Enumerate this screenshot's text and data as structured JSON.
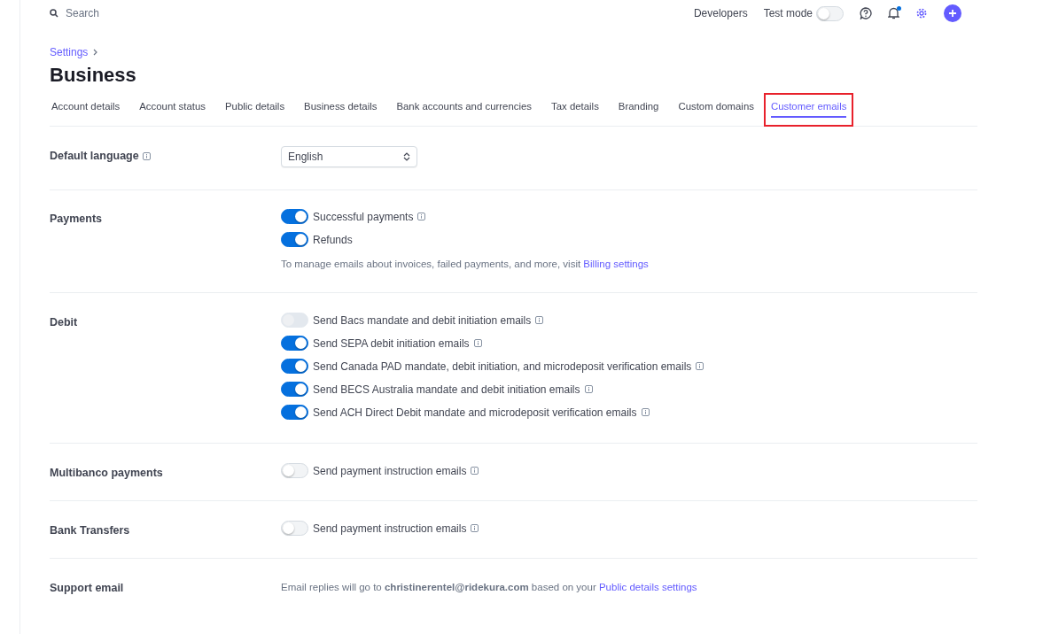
{
  "topbar": {
    "search": {
      "placeholder": "Search"
    },
    "developers": "Developers",
    "test_mode": {
      "label": "Test mode",
      "on": false
    }
  },
  "breadcrumb": "Settings",
  "title": "Business",
  "tabs": [
    {
      "label": "Account details",
      "selected": false,
      "highlighted": false
    },
    {
      "label": "Account status",
      "selected": false,
      "highlighted": false
    },
    {
      "label": "Public details",
      "selected": false,
      "highlighted": false
    },
    {
      "label": "Business details",
      "selected": false,
      "highlighted": false
    },
    {
      "label": "Bank accounts and currencies",
      "selected": false,
      "highlighted": false
    },
    {
      "label": "Tax details",
      "selected": false,
      "highlighted": false
    },
    {
      "label": "Branding",
      "selected": false,
      "highlighted": false
    },
    {
      "label": "Custom domains",
      "selected": false,
      "highlighted": false
    },
    {
      "label": "Customer emails",
      "selected": true,
      "highlighted": true
    }
  ],
  "sections": [
    {
      "kind": "select",
      "label": "Default language",
      "info": true,
      "value": "English"
    },
    {
      "kind": "toggles",
      "label": "Payments",
      "toggles": [
        {
          "label": "Successful payments",
          "on": true,
          "disabled": false,
          "info": true
        },
        {
          "label": "Refunds",
          "on": true,
          "disabled": false,
          "info": false
        }
      ],
      "note": {
        "text": "To manage emails about invoices, failed payments, and more, visit",
        "link": "Billing settings"
      }
    },
    {
      "kind": "toggles",
      "label": "Debit",
      "toggles": [
        {
          "label": "Send Bacs mandate and debit initiation emails",
          "on": false,
          "disabled": true,
          "info": true
        },
        {
          "label": "Send SEPA debit initiation emails",
          "on": true,
          "disabled": false,
          "info": true
        },
        {
          "label": "Send Canada PAD mandate, debit initiation, and microdeposit verification emails",
          "on": true,
          "disabled": false,
          "info": true
        },
        {
          "label": "Send BECS Australia mandate and debit initiation emails",
          "on": true,
          "disabled": false,
          "info": true
        },
        {
          "label": "Send ACH Direct Debit mandate and microdeposit verification emails",
          "on": true,
          "disabled": false,
          "info": true
        }
      ]
    },
    {
      "kind": "toggles",
      "label": "Multibanco payments",
      "toggles": [
        {
          "label": "Send payment instruction emails",
          "on": false,
          "disabled": false,
          "info": true
        }
      ]
    },
    {
      "kind": "toggles",
      "label": "Bank Transfers",
      "toggles": [
        {
          "label": "Send payment instruction emails",
          "on": false,
          "disabled": false,
          "info": true
        }
      ]
    },
    {
      "kind": "text",
      "label": "Support email",
      "note": {
        "text": "Email replies will go to **christinerentel@ridekura.com** based on your",
        "link": "Public details settings"
      }
    }
  ]
}
